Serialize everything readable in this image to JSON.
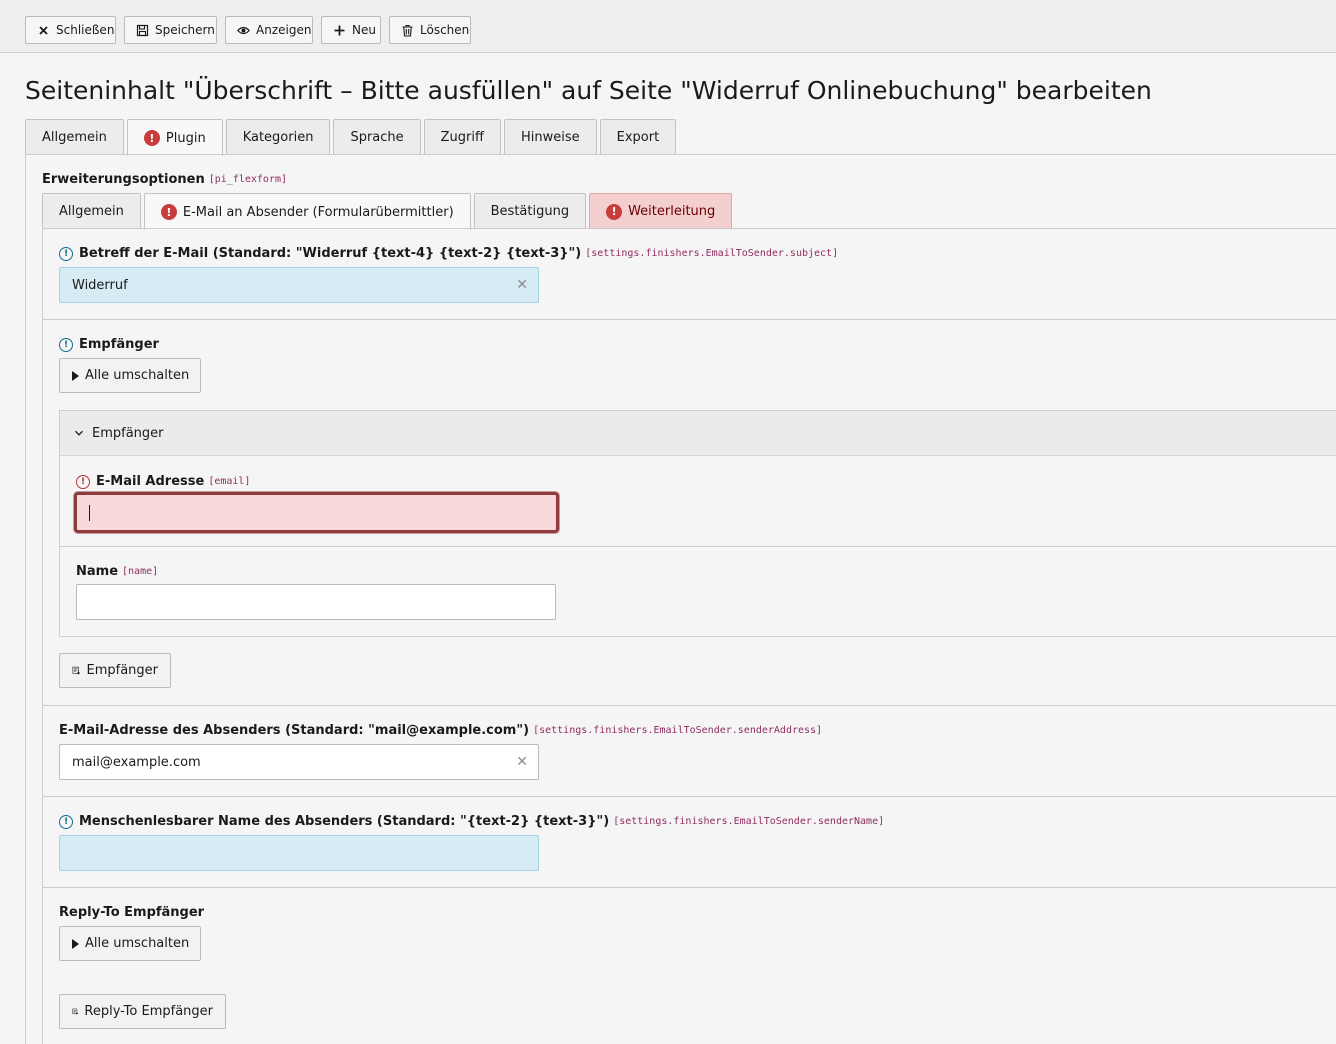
{
  "toolbar": {
    "close": "Schließen",
    "save": "Speichern",
    "view": "Anzeigen",
    "new": "Neu",
    "delete": "Löschen"
  },
  "page_title": "Seiteninhalt \"Überschrift – Bitte ausfüllen\" auf Seite \"Widerruf Onlinebuchung\" bearbeiten",
  "main_tabs": [
    "Allgemein",
    "Plugin",
    "Kategorien",
    "Sprache",
    "Zugriff",
    "Hinweise",
    "Export"
  ],
  "ext_options": {
    "label": "Erweiterungsoptionen",
    "code": "[pi_flexform]"
  },
  "sub_tabs": [
    "Allgemein",
    "E-Mail an Absender (Formularübermittler)",
    "Bestätigung",
    "Weiterleitung"
  ],
  "subject": {
    "label": "Betreff der E-Mail (Standard: \"Widerruf {text-4} {text-2} {text-3}\")",
    "code": "[settings.finishers.EmailToSender.subject]",
    "value": "Widerruf"
  },
  "recipients": {
    "label": "Empfänger",
    "toggle_all": "Alle umschalten",
    "panel_title": "Empfänger",
    "email_label": "E-Mail Adresse",
    "email_code": "[email]",
    "email_value": "",
    "name_label": "Name",
    "name_code": "[name]",
    "name_value": "",
    "add_button": "Empfänger"
  },
  "sender_address": {
    "label": "E-Mail-Adresse des Absenders (Standard: \"mail@example.com\")",
    "code": "[settings.finishers.EmailToSender.senderAddress]",
    "value": "mail@example.com"
  },
  "sender_name": {
    "label": "Menschenlesbarer Name des Absenders (Standard: \"{text-2} {text-3}\")",
    "code": "[settings.finishers.EmailToSender.senderName]",
    "value": ""
  },
  "reply_to": {
    "label": "Reply-To Empfänger",
    "toggle_all": "Alle umschalten",
    "add_button": "Reply-To Empfänger"
  },
  "colors": {
    "error": "#c83c3c",
    "changed_field": "#d6ecf4",
    "error_field": "#f7d9d9",
    "code_text": "#8e2e62"
  }
}
